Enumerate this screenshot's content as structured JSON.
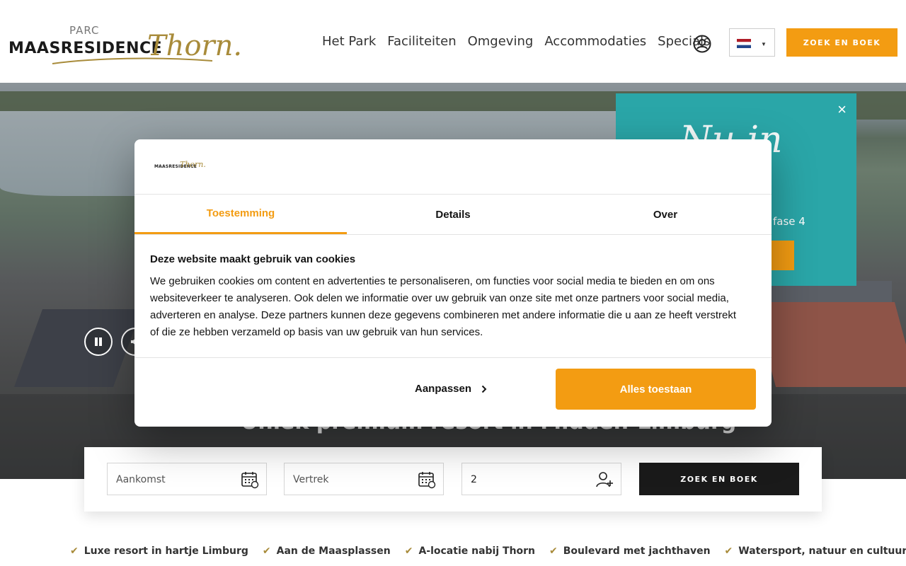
{
  "header": {
    "logo": {
      "small": "PARC",
      "main": "MAASRESIDENCE",
      "script": "Thorn."
    },
    "nav": [
      "Het Park",
      "Faciliteiten",
      "Omgeving",
      "Accommodaties",
      "Specials"
    ],
    "book_label": "ZOEK EN BOEK",
    "language": "nl-flag-icon"
  },
  "hero": {
    "tagline": "Uniek premium resort in Midden-Limburg"
  },
  "promo": {
    "script": "Nu in",
    "text": "fase 4"
  },
  "booking": {
    "arrival_placeholder": "Aankomst",
    "departure_placeholder": "Vertrek",
    "guests_value": "2",
    "submit_label": "ZOEK EN BOEK"
  },
  "usps": [
    "Luxe resort in hartje Limburg",
    "Aan de Maasplassen",
    "A-locatie nabij Thorn",
    "Boulevard met jachthaven",
    "Watersport, natuur en cultuur"
  ],
  "cookie": {
    "logo_main": "MAASRESIDENCE",
    "logo_script": "Thorn.",
    "tabs": [
      "Toestemming",
      "Details",
      "Over"
    ],
    "title": "Deze website maakt gebruik van cookies",
    "body": "We gebruiken cookies om content en advertenties te personaliseren, om functies voor social media te bieden en om ons websiteverkeer te analyseren. Ook delen we informatie over uw gebruik van onze site met onze partners voor social media, adverteren en analyse. Deze partners kunnen deze gegevens combineren met andere informatie die u aan ze heeft verstrekt of die ze hebben verzameld op basis van uw gebruik van hun services.",
    "customize_label": "Aanpassen",
    "allow_label": "Alles toestaan"
  },
  "colors": {
    "accent": "#f39c12",
    "gold": "#a88b3a",
    "teal": "#2aa6a8",
    "dark": "#1a1a1a"
  }
}
